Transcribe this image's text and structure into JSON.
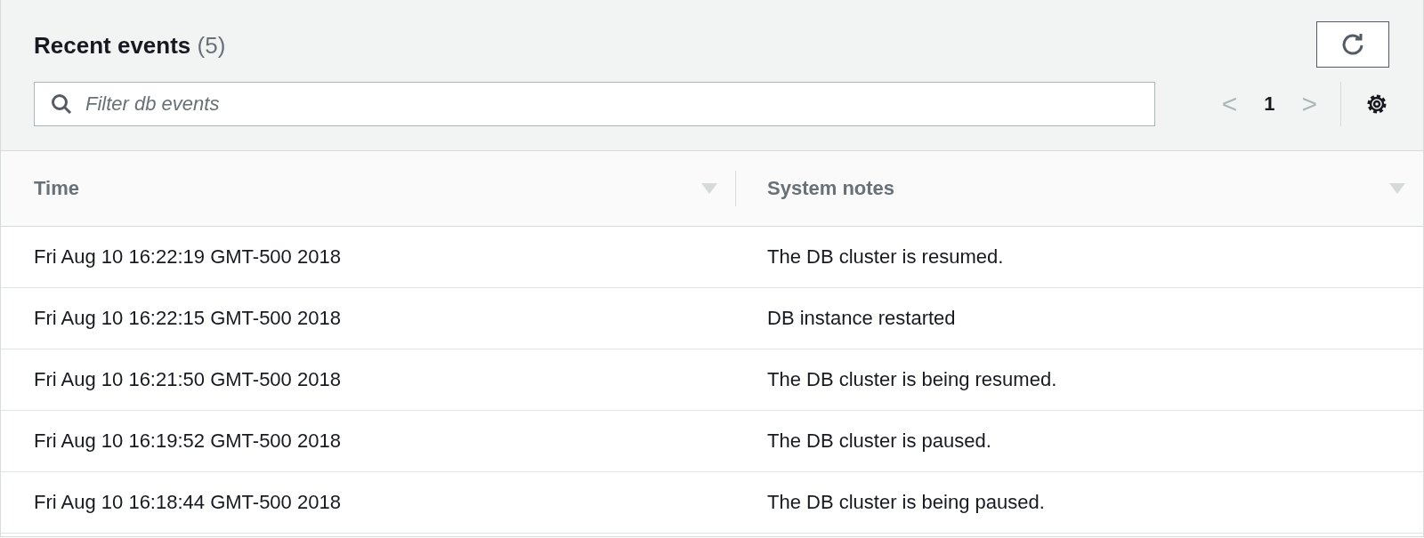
{
  "panel": {
    "title": "Recent events",
    "count": "(5)"
  },
  "search": {
    "placeholder": "Filter db events"
  },
  "pagination": {
    "prev": "<",
    "page": "1",
    "next": ">"
  },
  "table": {
    "columns": [
      "Time",
      "System notes"
    ],
    "rows": [
      [
        "Fri Aug 10 16:22:19 GMT-500 2018",
        "The DB cluster is resumed."
      ],
      [
        "Fri Aug 10 16:22:15 GMT-500 2018",
        "DB instance restarted"
      ],
      [
        "Fri Aug 10 16:21:50 GMT-500 2018",
        "The DB cluster is being resumed."
      ],
      [
        "Fri Aug 10 16:19:52 GMT-500 2018",
        "The DB cluster is paused."
      ],
      [
        "Fri Aug 10 16:18:44 GMT-500 2018",
        "The DB cluster is being paused."
      ]
    ]
  }
}
